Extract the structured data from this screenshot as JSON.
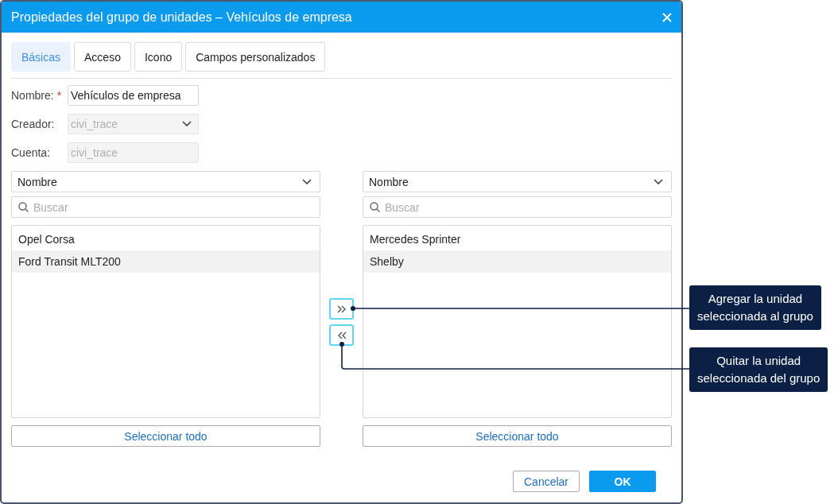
{
  "dialog": {
    "title": "Propiedades del grupo de unidades – Vehículos de empresa",
    "tabs": [
      {
        "label": "Básicas",
        "selected": true
      },
      {
        "label": "Acceso",
        "selected": false
      },
      {
        "label": "Icono",
        "selected": false
      },
      {
        "label": "Campos personalizados",
        "selected": false
      }
    ],
    "fields": [
      {
        "kind": "text",
        "label": "Nombre:",
        "required_mark": "*",
        "disabled": false,
        "value": "Vehículos de empresa"
      },
      {
        "kind": "select",
        "label": "Creador:",
        "disabled": true,
        "value": "civi_trace"
      },
      {
        "kind": "text",
        "label": "Cuenta:",
        "disabled": true,
        "value": "civi_trace"
      }
    ],
    "lists": [
      {
        "sort": "Nombre",
        "search_placeholder": "Buscar",
        "items": [
          {
            "name": "Opel Corsa",
            "selected": false
          },
          {
            "name": "Ford Transit MLT200",
            "selected": true
          }
        ],
        "select_all": "Seleccionar todo"
      },
      {
        "sort": "Nombre",
        "search_placeholder": "Buscar",
        "items": [
          {
            "name": "Mercedes Sprinter",
            "selected": false
          },
          {
            "name": "Shelby",
            "selected": true
          }
        ],
        "select_all": "Seleccionar todo"
      }
    ],
    "footer_buttons": [
      {
        "kind": "secondary",
        "label": "Cancelar"
      },
      {
        "kind": "primary",
        "label": "OK"
      }
    ]
  },
  "callouts": [
    {
      "text": "Agregar la unidad\nseleccionada al grupo"
    },
    {
      "text": "Quitar la unidad\nseleccionada del grupo"
    }
  ]
}
